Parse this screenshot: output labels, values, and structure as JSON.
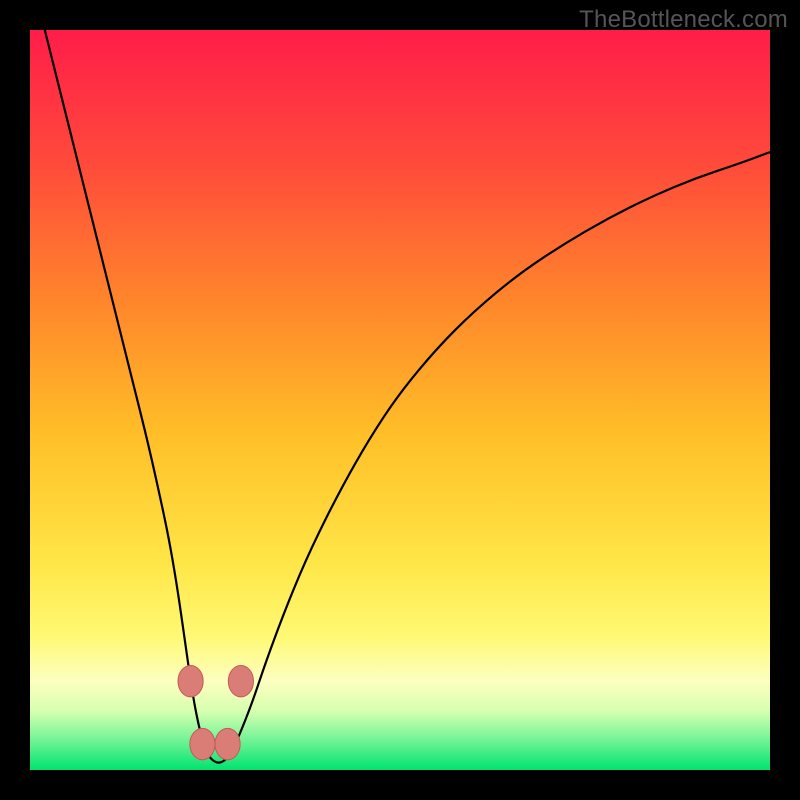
{
  "watermark": "TheBottleneck.com",
  "colors": {
    "frame": "#000000",
    "watermark": "#555555",
    "curve": "#000000",
    "marker_fill": "#da7d76",
    "marker_stroke": "#c55b55",
    "gradient_stops": [
      {
        "offset": 0.0,
        "color": "#ff1d49"
      },
      {
        "offset": 0.18,
        "color": "#ff4a3b"
      },
      {
        "offset": 0.38,
        "color": "#ff8a2a"
      },
      {
        "offset": 0.55,
        "color": "#ffc028"
      },
      {
        "offset": 0.72,
        "color": "#ffe647"
      },
      {
        "offset": 0.82,
        "color": "#fff974"
      },
      {
        "offset": 0.88,
        "color": "#fcffc0"
      },
      {
        "offset": 0.92,
        "color": "#d7ffb0"
      },
      {
        "offset": 0.955,
        "color": "#7ef59a"
      },
      {
        "offset": 1.0,
        "color": "#00e36f"
      }
    ]
  },
  "chart_data": {
    "type": "line",
    "title": "",
    "xlabel": "",
    "ylabel": "",
    "xlim": [
      0,
      100
    ],
    "ylim": [
      0,
      100
    ],
    "series": [
      {
        "name": "curve",
        "x": [
          2,
          4,
          6,
          8,
          10,
          12,
          14,
          16,
          18,
          19,
          20,
          21,
          22,
          23,
          24,
          25,
          26,
          27,
          28,
          30,
          32,
          35,
          38,
          42,
          46,
          50,
          55,
          60,
          66,
          72,
          78,
          84,
          90,
          96,
          100
        ],
        "y": [
          100,
          92,
          84,
          76,
          68,
          60,
          52,
          44,
          35,
          30,
          24,
          17,
          10,
          5,
          2,
          1,
          1,
          2,
          4,
          9,
          15,
          23,
          30,
          38,
          45,
          51,
          57,
          62,
          67,
          71,
          74.5,
          77.5,
          80,
          82,
          83.5
        ]
      }
    ],
    "markers": {
      "name": "bottom-markers",
      "points": [
        {
          "x": 21.7,
          "y": 12
        },
        {
          "x": 23.3,
          "y": 3.5
        },
        {
          "x": 26.7,
          "y": 3.5
        },
        {
          "x": 28.5,
          "y": 12
        }
      ],
      "radius_pct": 1.7
    }
  }
}
